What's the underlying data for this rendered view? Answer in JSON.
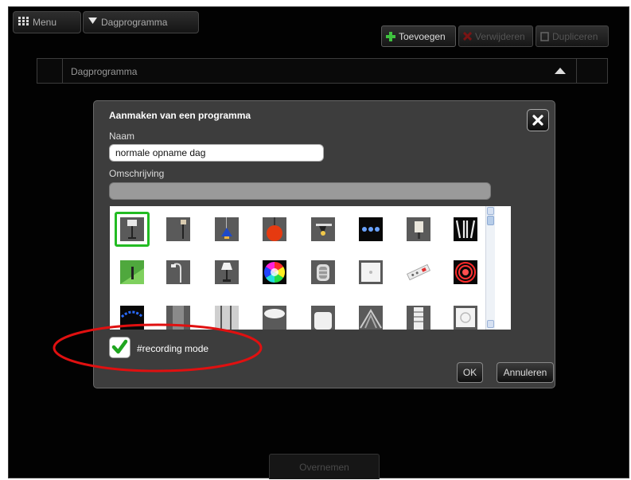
{
  "topbar": {
    "menu_label": "Menu",
    "dropdown_label": "Dagprogramma"
  },
  "actions": {
    "add_label": "Toevoegen",
    "delete_label": "Verwijderen",
    "duplicate_label": "Dupliceren"
  },
  "list": {
    "header": "Dagprogramma"
  },
  "bottom": {
    "adopt_label": "Overnemen"
  },
  "dialog": {
    "title": "Aanmaken van een programma",
    "name_label": "Naam",
    "name_value": "normale opname dag",
    "description_label": "Omschrijving",
    "description_value": "",
    "icons": [
      {
        "name": "floor-lamp-icon",
        "selected": true
      },
      {
        "name": "standing-lamp-icon"
      },
      {
        "name": "blue-pendant-lamp-icon"
      },
      {
        "name": "orange-pendant-lamp-icon"
      },
      {
        "name": "spot-light-icon"
      },
      {
        "name": "led-strip-icon"
      },
      {
        "name": "wall-lamp-icon"
      },
      {
        "name": "ceiling-panel-icon"
      },
      {
        "name": "garden-light-icon"
      },
      {
        "name": "arc-lamp-icon"
      },
      {
        "name": "table-lamp-icon"
      },
      {
        "name": "rgb-light-icon"
      },
      {
        "name": "bulkhead-light-icon"
      },
      {
        "name": "wall-switch-icon"
      },
      {
        "name": "power-strip-icon"
      },
      {
        "name": "red-heater-icon"
      },
      {
        "name": "gas-flame-icon"
      },
      {
        "name": "oven-icon"
      },
      {
        "name": "shower-icon"
      },
      {
        "name": "cup-icon"
      },
      {
        "name": "toaster-icon"
      },
      {
        "name": "fan-icon"
      },
      {
        "name": "radiator-icon"
      },
      {
        "name": "wall-socket-icon"
      }
    ],
    "checkbox_checked": true,
    "checkbox_label": "#recording mode",
    "ok_label": "OK",
    "cancel_label": "Annuleren"
  },
  "colors": {
    "accent_green": "#23bb23",
    "highlight_red": "#e01010",
    "background": "#020202"
  }
}
